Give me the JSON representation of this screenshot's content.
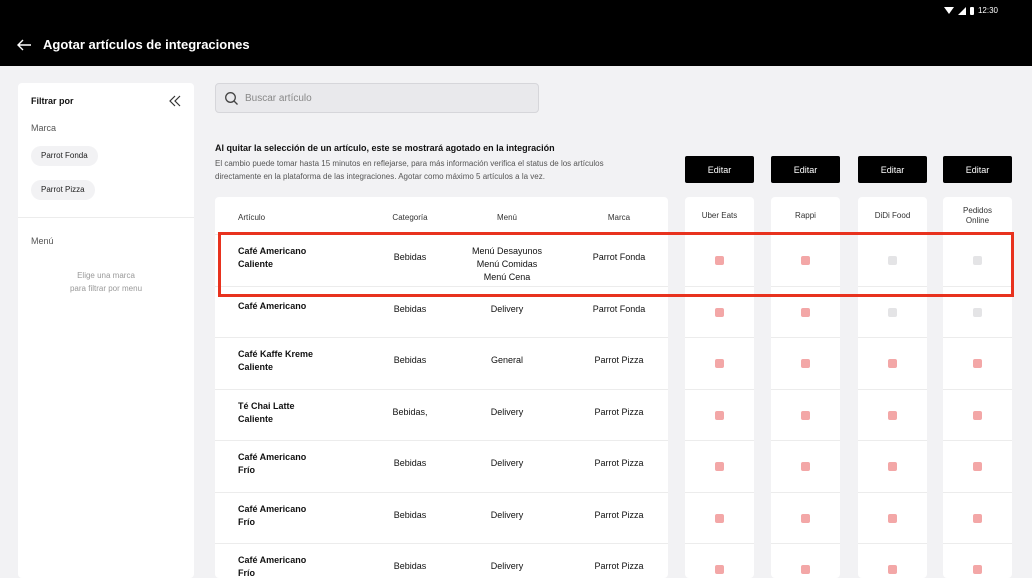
{
  "status": {
    "time": "12:30",
    "icons": [
      "wifi-icon",
      "signal-icon",
      "battery-icon"
    ]
  },
  "header": {
    "title": "Agotar artículos de integraciones",
    "back_icon": "back-arrow-icon"
  },
  "sidebar": {
    "title": "Filtrar por",
    "marca_label": "Marca",
    "brands": [
      "Parrot Fonda",
      "Parrot Pizza"
    ],
    "menu_label": "Menú",
    "hint_line1": "Elige una marca",
    "hint_line2": "para filtrar por menu"
  },
  "search": {
    "placeholder": "Buscar artículo",
    "value": ""
  },
  "info": {
    "title": "Al quitar la selección de un artículo, este se mostrará agotado en la integración",
    "line1": "El cambio puede tomar hasta 15 minutos en reflejarse, para más información verifica el status de los artículos",
    "line2": "directamente en la plataforma de las integraciones. Agotar como máximo 5 artículos a la vez."
  },
  "edit_label": "Editar",
  "table": {
    "columns": {
      "article": "Artículo",
      "category": "Categoría",
      "menu": "Menú",
      "brand": "Marca"
    },
    "integrations": [
      {
        "name": "Uber Eats",
        "line2": ""
      },
      {
        "name": "Rappi",
        "line2": ""
      },
      {
        "name": "DiDi Food",
        "line2": ""
      },
      {
        "name": "Pedidos",
        "line2": "Online"
      }
    ],
    "rows": [
      {
        "a1": "Café Americano",
        "a2": "Caliente",
        "category": "Bebidas",
        "m1": "Menú Desayunos",
        "m2": "Menú Comidas",
        "m3": "Menú Cena",
        "brand": "Parrot Fonda",
        "checks": [
          true,
          true,
          false,
          false
        ]
      },
      {
        "a1": "Café Americano",
        "a2": "",
        "category": "Bebidas",
        "m1": "Delivery",
        "m2": "",
        "m3": "",
        "brand": "Parrot Fonda",
        "checks": [
          true,
          true,
          false,
          false
        ]
      },
      {
        "a1": "Café Kaffe Kreme",
        "a2": "Caliente",
        "category": "Bebidas",
        "m1": "General",
        "m2": "",
        "m3": "",
        "brand": "Parrot Pizza",
        "checks": [
          true,
          true,
          true,
          true
        ]
      },
      {
        "a1": "Té Chai Latte",
        "a2": "Caliente",
        "category": "Bebidas,",
        "m1": "Delivery",
        "m2": "",
        "m3": "",
        "brand": "Parrot Pizza",
        "checks": [
          true,
          true,
          true,
          true
        ]
      },
      {
        "a1": "Café Americano",
        "a2": "Frío",
        "category": "Bebidas",
        "m1": "Delivery",
        "m2": "",
        "m3": "",
        "brand": "Parrot Pizza",
        "checks": [
          true,
          true,
          true,
          true
        ]
      },
      {
        "a1": "Café Americano",
        "a2": "Frío",
        "category": "Bebidas",
        "m1": "Delivery",
        "m2": "",
        "m3": "",
        "brand": "Parrot Pizza",
        "checks": [
          true,
          true,
          true,
          true
        ]
      },
      {
        "a1": "Café Americano",
        "a2": "Frío",
        "category": "Bebidas",
        "m1": "Delivery",
        "m2": "",
        "m3": "",
        "brand": "Parrot Pizza",
        "checks": [
          true,
          true,
          true,
          true
        ]
      }
    ]
  },
  "colors": {
    "highlight": "#e8321e",
    "checked": "#f3a7a7",
    "unchecked": "#e4e4e6",
    "header_bg": "#000000"
  }
}
